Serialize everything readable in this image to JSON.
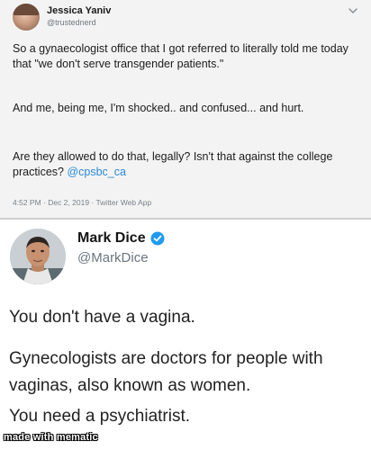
{
  "tweet1": {
    "display_name": "Jessica Yaniv",
    "handle": "@trustednerd",
    "paragraphs": {
      "p1": "So a gynaecologist office that I got referred to literally told me today that \"we don't serve transgender patients.\"",
      "p2": "And me, being me, I'm shocked.. and confused... and hurt.",
      "p3_text": "Are they allowed to do that, legally? Isn't that against the college practices? ",
      "p3_mention": "@cpsbc_ca"
    },
    "meta": "4:52 PM · Dec 2, 2019 · Twitter Web App",
    "menu_icon": "chevron-down-icon"
  },
  "tweet2": {
    "display_name": "Mark Dice",
    "handle": "@MarkDice",
    "verified_icon": "verified-badge-icon",
    "lines": {
      "l1": "You don't have a vagina.",
      "l2": "Gynecologists are doctors for people with vaginas, also known as women.",
      "l3": "You need a psychiatrist."
    }
  },
  "watermark": "made with mematic",
  "colors": {
    "mention": "#2a8bd8",
    "verified": "#1d9bf0",
    "tweet1_bg": "#f3f3f3"
  }
}
